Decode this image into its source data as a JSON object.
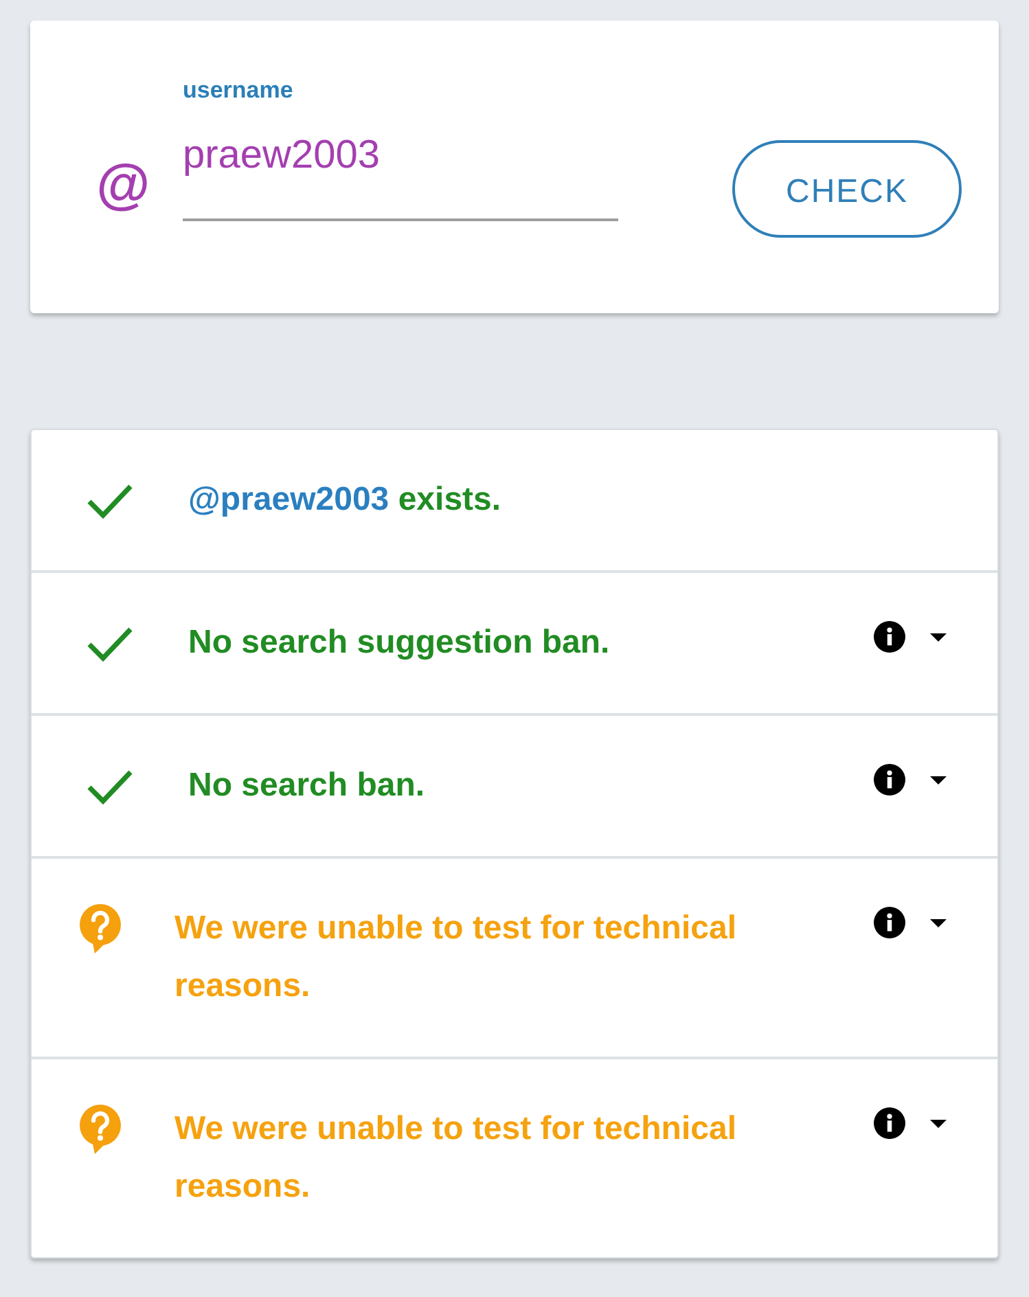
{
  "search": {
    "prefix": "@",
    "label": "username",
    "value": "praew2003",
    "button": "CHECK"
  },
  "results": [
    {
      "kind": "ok",
      "handle": "@praew2003",
      "text": "exists.",
      "has_info": false
    },
    {
      "kind": "ok",
      "text": "No search suggestion ban.",
      "has_info": true
    },
    {
      "kind": "ok",
      "text": "No search ban.",
      "has_info": true
    },
    {
      "kind": "unknown",
      "text": "We were unable to test for technical reasons.",
      "has_info": true
    },
    {
      "kind": "unknown",
      "text": "We were unable to test for technical reasons.",
      "has_info": true
    }
  ]
}
